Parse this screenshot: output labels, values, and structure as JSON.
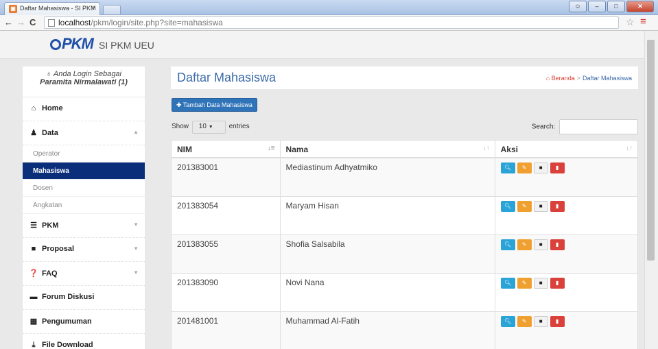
{
  "browser": {
    "tab_title": "Daftar Mahasiswa - SI PKM",
    "tab_close": "×",
    "url_host": "localhost",
    "url_path": "/pkm/login/site.php?site=mahasiswa",
    "back": "←",
    "forward": "→",
    "reload": "C",
    "star": "☆",
    "menu": "≡"
  },
  "header": {
    "logo_text": "PKM",
    "site_title": "SI PKM UEU"
  },
  "sidebar": {
    "login_label": "Anda Login Sebagai",
    "user_name": "Paramita Nirmalawati (1)",
    "items": [
      {
        "label": "Home",
        "icon": "home-icon",
        "glyph": "⌂",
        "caret": ""
      },
      {
        "label": "Data",
        "icon": "user-icon",
        "glyph": "♟",
        "caret": "▲"
      },
      {
        "label": "PKM",
        "icon": "list-icon",
        "glyph": "☰",
        "caret": "▼"
      },
      {
        "label": "Proposal",
        "icon": "book-icon",
        "glyph": "■",
        "caret": "▼"
      },
      {
        "label": "FAQ",
        "icon": "question-icon",
        "glyph": "❓",
        "caret": "▼"
      },
      {
        "label": "Forum Diskusi",
        "icon": "comment-icon",
        "glyph": "▬",
        "caret": ""
      },
      {
        "label": "Pengumuman",
        "icon": "grid-icon",
        "glyph": "▦",
        "caret": ""
      },
      {
        "label": "File Download",
        "icon": "download-icon",
        "glyph": "⤓",
        "caret": ""
      }
    ],
    "sub_items": [
      "Operator",
      "Mahasiswa",
      "Dosen",
      "Angkatan"
    ],
    "active_sub": "Mahasiswa"
  },
  "main": {
    "page_title": "Daftar Mahasiswa",
    "breadcrumb_home": "Beranda",
    "breadcrumb_sep": ">",
    "breadcrumb_current": "Daftar Mahasiswa",
    "add_button": "Tambah Data Mahasiswa",
    "show_label": "Show",
    "entries_value": "10",
    "entries_label": "entries",
    "search_label": "Search:",
    "search_value": "",
    "columns": [
      "NIM",
      "Nama",
      "Aksi"
    ],
    "rows": [
      {
        "nim": "201383001",
        "nama": "Mediastinum Adhyatmiko"
      },
      {
        "nim": "201383054",
        "nama": "Maryam Hisan"
      },
      {
        "nim": "201383055",
        "nama": "Shofia Salsabila"
      },
      {
        "nim": "201383090",
        "nama": "Novi Nana"
      },
      {
        "nim": "201481001",
        "nama": "Muhammad Al-Fatih"
      }
    ]
  },
  "colors": {
    "accent": "#3a6aa8",
    "active_nav": "#0b2e7a",
    "btn_primary": "#2f73b8",
    "btn_view": "#2aa3d6",
    "btn_edit": "#f0a030",
    "btn_delete": "#d9413a"
  }
}
